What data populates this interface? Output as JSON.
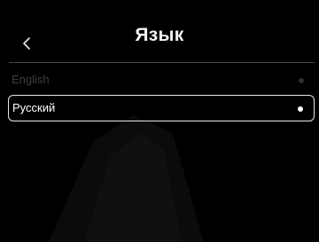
{
  "header": {
    "title": "Язык",
    "back_icon": "chevron-left-icon"
  },
  "languages": [
    {
      "label": "English",
      "selected": false
    },
    {
      "label": "Русский",
      "selected": true
    }
  ],
  "colors": {
    "background": "#000000",
    "text": "#ffffff",
    "dimmed_text": "#3f3f3f",
    "selection_border": "#e8e8e8",
    "divider": "#4a4a4a"
  }
}
